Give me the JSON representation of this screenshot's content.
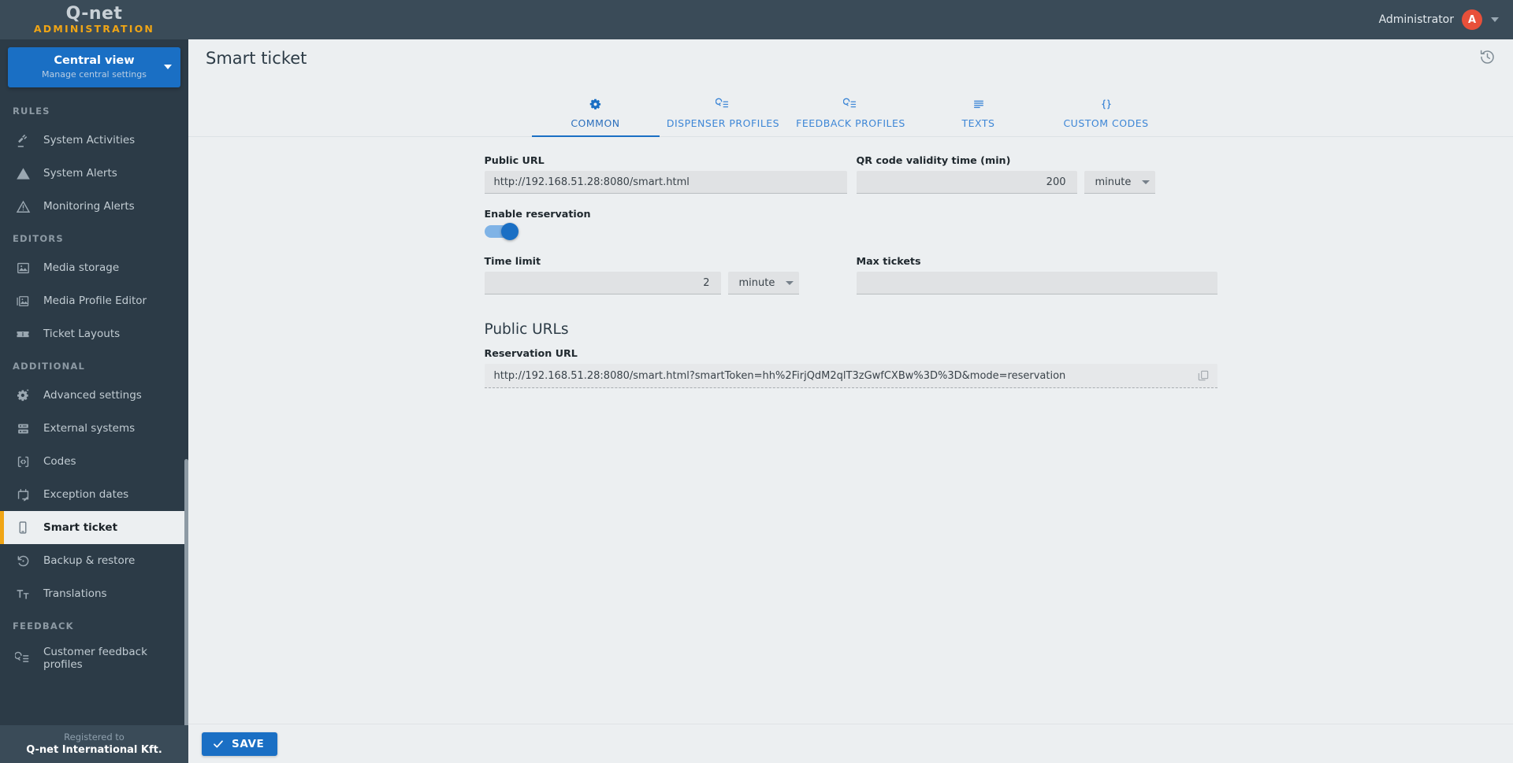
{
  "brand": {
    "logo": "Q-net",
    "logo_sub": "ADMINISTRATION"
  },
  "topbar": {
    "user": "Administrator",
    "avatar_initial": "A"
  },
  "view_switcher": {
    "title": "Central view",
    "subtitle": "Manage central settings"
  },
  "sidebar": {
    "sections": [
      {
        "label": "RULES",
        "items": [
          {
            "label": "System Activities",
            "icon": "gavel-icon",
            "active": false
          },
          {
            "label": "System Alerts",
            "icon": "alert-filled-icon",
            "active": false
          },
          {
            "label": "Monitoring Alerts",
            "icon": "alert-outline-icon",
            "active": false
          }
        ]
      },
      {
        "label": "EDITORS",
        "items": [
          {
            "label": "Media storage",
            "icon": "image-icon",
            "active": false
          },
          {
            "label": "Media Profile Editor",
            "icon": "image-stack-icon",
            "active": false
          },
          {
            "label": "Ticket Layouts",
            "icon": "ticket-icon",
            "active": false
          }
        ]
      },
      {
        "label": "ADDITIONAL",
        "items": [
          {
            "label": "Advanced settings",
            "icon": "gear-sparkle-icon",
            "active": false
          },
          {
            "label": "External systems",
            "icon": "server-icon",
            "active": false
          },
          {
            "label": "Codes",
            "icon": "code-brackets-icon",
            "active": false
          },
          {
            "label": "Exception dates",
            "icon": "calendar-edit-icon",
            "active": false
          },
          {
            "label": "Smart ticket",
            "icon": "smartphone-icon",
            "active": true
          },
          {
            "label": "Backup & restore",
            "icon": "restore-icon",
            "active": false
          },
          {
            "label": "Translations",
            "icon": "translate-icon",
            "active": false
          }
        ]
      },
      {
        "label": "FEEDBACK",
        "items": [
          {
            "label": "Customer feedback profiles",
            "icon": "feedback-icon",
            "active": false
          }
        ]
      }
    ],
    "footer": {
      "line1": "Registered to",
      "line2": "Q-net International Kft."
    }
  },
  "page": {
    "title": "Smart ticket",
    "history_icon": "history-icon"
  },
  "tabs": [
    {
      "label": "COMMON",
      "icon": "gear-icon",
      "active": true
    },
    {
      "label": "DISPENSER PROFILES",
      "icon": "profile-list-icon",
      "active": false
    },
    {
      "label": "FEEDBACK PROFILES",
      "icon": "profile-list-icon",
      "active": false
    },
    {
      "label": "TEXTS",
      "icon": "text-lines-icon",
      "active": false
    },
    {
      "label": "CUSTOM CODES",
      "icon": "braces-icon",
      "active": false
    }
  ],
  "form": {
    "public_url": {
      "label": "Public URL",
      "value": "http://192.168.51.28:8080/smart.html"
    },
    "qr_validity": {
      "label": "QR code validity time (min)",
      "value": "200",
      "unit": "minute"
    },
    "enable_reservation": {
      "label": "Enable reservation",
      "checked": "true"
    },
    "time_limit": {
      "label": "Time limit",
      "value": "2",
      "unit": "minute"
    },
    "max_tickets": {
      "label": "Max tickets",
      "value": ""
    },
    "public_urls_title": "Public URLs",
    "reservation_url": {
      "label": "Reservation URL",
      "value": "http://192.168.51.28:8080/smart.html?smartToken=hh%2FirjQdM2qlT3zGwfCXBw%3D%3D&mode=reservation",
      "copy_icon": "copy-icon"
    }
  },
  "savebar": {
    "save_label": "SAVE",
    "check_icon": "check-icon"
  },
  "colors": {
    "sidebar_bg": "#2c3b47",
    "sidebar_header_bg": "#3a4b58",
    "accent_blue": "#1a6fc4",
    "accent_orange": "#f0a515",
    "avatar_red": "#e8503a",
    "content_bg": "#eceff1",
    "tab_blue": "#3d86d6"
  }
}
